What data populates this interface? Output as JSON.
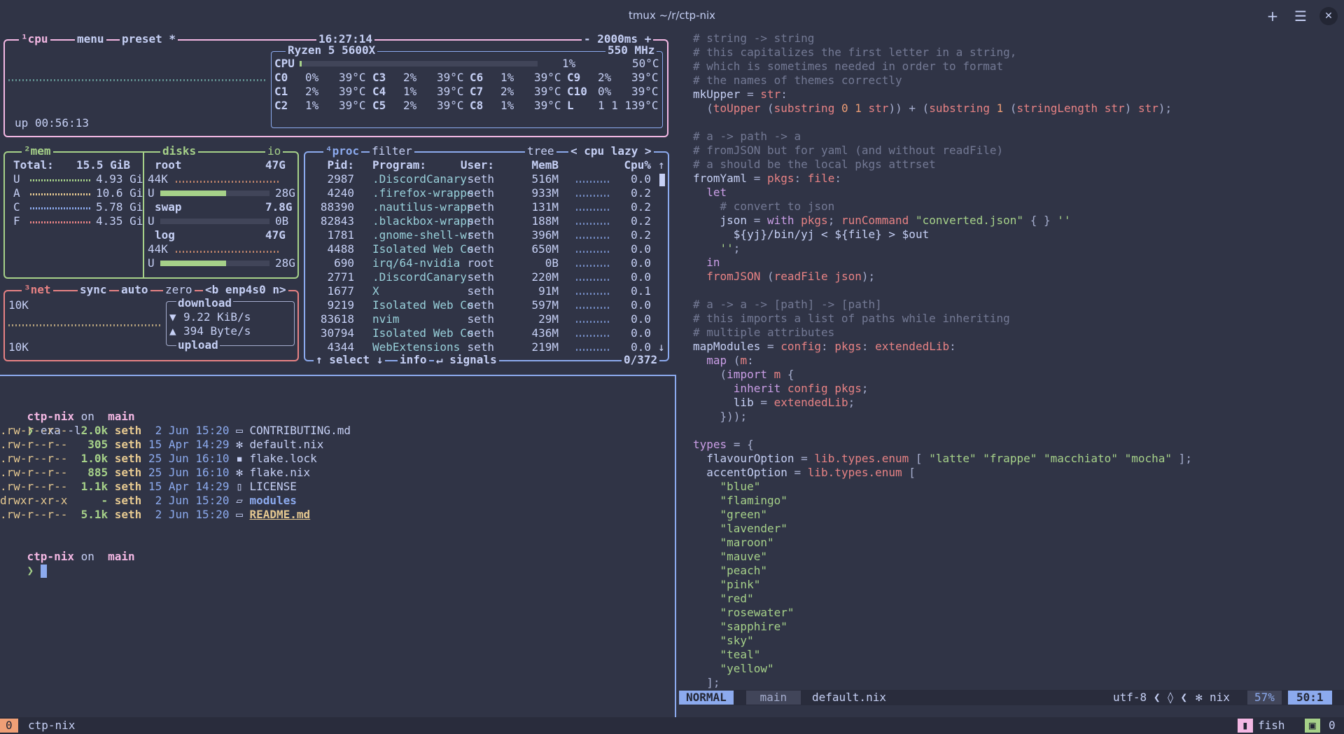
{
  "window": {
    "title": "tmux ~/r/ctp-nix",
    "add_label": "+",
    "menu_label": "☰",
    "close_label": "✕"
  },
  "btop": {
    "cpu_box": {
      "title": "¹cpu",
      "menu": "menu",
      "preset": "preset *",
      "clock": "16:27:14",
      "interval": "- 2000ms +",
      "cpu_model": "Ryzen 5 5600X",
      "freq": "550 MHz",
      "uptime": "up 00:56:13",
      "total": {
        "label": "CPU",
        "pct": "1%",
        "temp": "50°C",
        "fill": 0.01
      },
      "cores": [
        [
          "C0",
          "0%",
          "39°C",
          "C3",
          "2%",
          "39°C",
          "C6",
          "1%",
          "39°C",
          "C9",
          "2%",
          "39°C"
        ],
        [
          "C1",
          "2%",
          "39°C",
          "C4",
          "1%",
          "39°C",
          "C7",
          "2%",
          "39°C",
          "C10",
          "0%",
          "39°C"
        ],
        [
          "C2",
          "1%",
          "39°C",
          "C5",
          "2%",
          "39°C",
          "C8",
          "1%",
          "39°C",
          "L",
          "1 1 1",
          "39°C"
        ]
      ]
    },
    "mem_box": {
      "title": "²mem",
      "total_label": "Total:",
      "total_value": "15.5 GiB",
      "rows": [
        [
          "U",
          "4.93 Gi"
        ],
        [
          "A",
          "10.6 Gi"
        ],
        [
          "C",
          "5.78 Gi"
        ],
        [
          "F",
          "4.35 Gi"
        ]
      ],
      "disks_title": "disks",
      "io_title": "io",
      "disks": [
        {
          "name": "root",
          "size": "47G",
          "io": "44K",
          "used_label": "U",
          "used": "28G",
          "fill": 0.6
        },
        {
          "name": "swap",
          "size": "7.8G",
          "used_label": "U",
          "used": "0B",
          "fill": 0.0
        },
        {
          "name": "log",
          "size": "47G",
          "io": "44K",
          "used_label": "U",
          "used": "28G",
          "fill": 0.6
        }
      ]
    },
    "net_box": {
      "title": "³net",
      "sync": "sync",
      "auto": "auto",
      "zero": "zero",
      "iface": "<b enp4s0 n>",
      "top_scale": "10K",
      "bottom_scale": "10K",
      "download_label": "download",
      "download_value": "9.22 KiB/s",
      "upload_label": "upload",
      "upload_value": "394 Byte/s"
    },
    "proc_box": {
      "title": "⁴proc",
      "filter": "filter",
      "tree": "tree",
      "sort": "< cpu lazy >",
      "headers": [
        "Pid:",
        "Program:",
        "User:",
        "MemB",
        "Cpu%"
      ],
      "rows": [
        [
          "2987",
          ".DiscordCanary-",
          "seth",
          "516M",
          "0.0"
        ],
        [
          "4240",
          ".firefox-wrappe",
          "seth",
          "933M",
          "0.2"
        ],
        [
          "88390",
          ".nautilus-wrapp",
          "seth",
          "131M",
          "0.2"
        ],
        [
          "82843",
          ".blackbox-wrapp",
          "seth",
          "188M",
          "0.2"
        ],
        [
          "1781",
          ".gnome-shell-wr",
          "seth",
          "396M",
          "0.2"
        ],
        [
          "4488",
          "Isolated Web Co",
          "seth",
          "650M",
          "0.0"
        ],
        [
          "690",
          "irq/64-nvidia",
          "root",
          "0B",
          "0.0"
        ],
        [
          "2771",
          ".DiscordCanary-",
          "seth",
          "220M",
          "0.0"
        ],
        [
          "1677",
          "X",
          "seth",
          "91M",
          "0.1"
        ],
        [
          "9219",
          "Isolated Web Co",
          "seth",
          "597M",
          "0.0"
        ],
        [
          "83618",
          "nvim",
          "seth",
          "29M",
          "0.0"
        ],
        [
          "30794",
          "Isolated Web Co",
          "seth",
          "436M",
          "0.0"
        ],
        [
          "4344",
          "WebExtensions",
          "seth",
          "219M",
          "0.0"
        ]
      ],
      "footer_select": "↑ select ↓",
      "footer_info": "info",
      "footer_signals": "↵ signals",
      "count": "0/372"
    }
  },
  "shell": {
    "prompt1": {
      "dir": "ctp-nix",
      "on": "on",
      "branch": " main"
    },
    "command": "exa -l",
    "files": [
      {
        "perm": ".rw-r--r--",
        "size": "2.0k",
        "user": "seth",
        "date": " 2 Jun 15:20",
        "icon": "▭",
        "name": "CONTRIBUTING.md"
      },
      {
        "perm": ".rw-r--r--",
        "size": "305",
        "user": "seth",
        "date": "15 Apr 14:29",
        "icon": "✻",
        "name": "default.nix"
      },
      {
        "perm": ".rw-r--r--",
        "size": "1.0k",
        "user": "seth",
        "date": "25 Jun 16:10",
        "icon": "▪",
        "name": "flake.lock"
      },
      {
        "perm": ".rw-r--r--",
        "size": "885",
        "user": "seth",
        "date": "25 Jun 16:10",
        "icon": "✻",
        "name": "flake.nix"
      },
      {
        "perm": ".rw-r--r--",
        "size": "1.1k",
        "user": "seth",
        "date": "15 Apr 14:29",
        "icon": "▯",
        "name": "LICENSE"
      },
      {
        "perm": "drwxr-xr-x",
        "size": "-",
        "user": "seth",
        "date": " 2 Jun 15:20",
        "icon": "▱",
        "name": "modules"
      },
      {
        "perm": ".rw-r--r--",
        "size": "5.1k",
        "user": "seth",
        "date": " 2 Jun 15:20",
        "icon": "▭",
        "name": "README.md"
      }
    ],
    "prompt2": {
      "dir": "ctp-nix",
      "on": "on",
      "branch": " main"
    },
    "prompt_char": "❯"
  },
  "editor": {
    "lines": [
      "# string -> string",
      "# this capitalizes the first letter in a string,",
      "# which is sometimes needed in order to format",
      "# the names of themes correctly",
      "mkUpper = str:",
      "  (toUpper (substring 0 1 str)) + (substring 1 (stringLength str) str);",
      "",
      "# a -> path -> a",
      "# fromJSON but for yaml (and without readFile)",
      "# a should be the local pkgs attrset",
      "fromYaml = pkgs: file:",
      "  let",
      "    # convert to json",
      "    json = with pkgs; runCommand \"converted.json\" { } ''",
      "      ${yj}/bin/yj < ${file} > $out",
      "    '';",
      "  in",
      "  fromJSON (readFile json);",
      "",
      "# a -> a -> [path] -> [path]",
      "# this imports a list of paths while inheriting",
      "# multiple attributes",
      "mapModules = config: pkgs: extendedLib:",
      "  map (m:",
      "    (import m {",
      "      inherit config pkgs;",
      "      lib = extendedLib;",
      "    }));",
      "",
      "types = {",
      "  flavourOption = lib.types.enum [ \"latte\" \"frappe\" \"macchiato\" \"mocha\" ];",
      "  accentOption = lib.types.enum [",
      "    \"blue\"",
      "    \"flamingo\"",
      "    \"green\"",
      "    \"lavender\"",
      "    \"maroon\"",
      "    \"mauve\"",
      "    \"peach\"",
      "    \"pink\"",
      "    \"red\"",
      "    \"rosewater\"",
      "    \"sapphire\"",
      "    \"sky\"",
      "    \"teal\"",
      "    \"yellow\"",
      "  ];"
    ],
    "status": {
      "mode": "NORMAL",
      "branch": " main",
      "file": "default.nix",
      "encoding": "utf-8",
      "filetype": "nix",
      "percent": "57%",
      "position": "50:1"
    }
  },
  "tmux": {
    "index": "0",
    "session": "ctp-nix",
    "right_shell": "fish",
    "right_index": "0"
  }
}
